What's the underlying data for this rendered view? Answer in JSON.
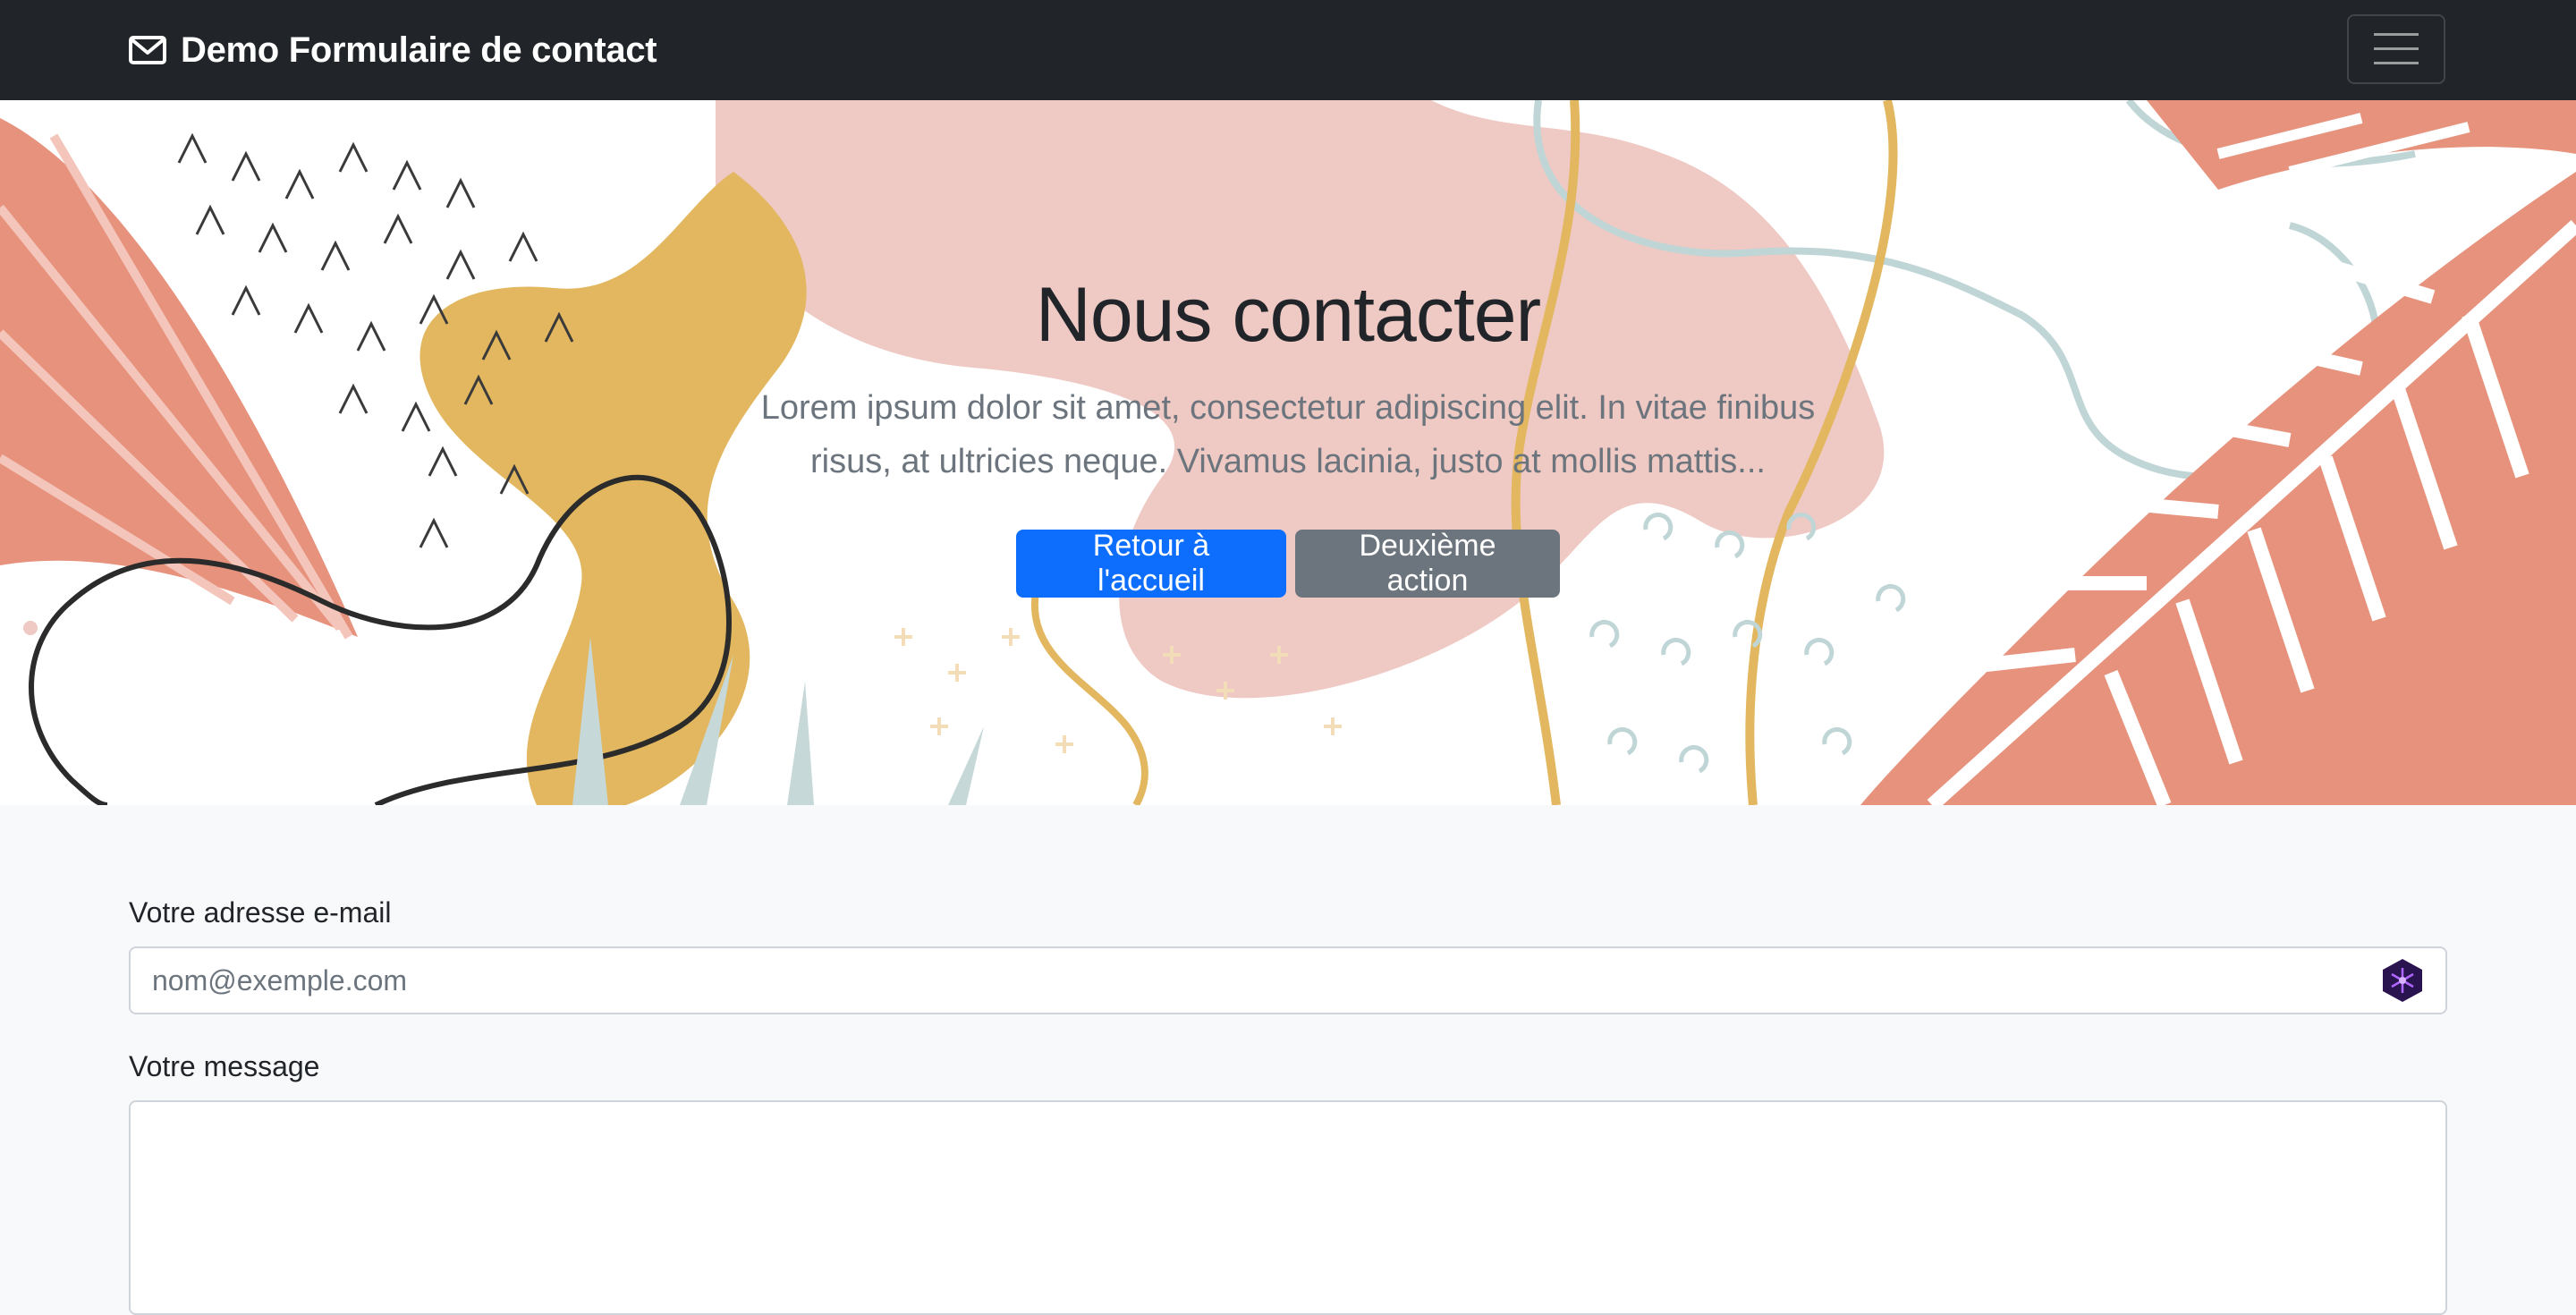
{
  "navbar": {
    "brand_text": "Demo Formulaire de contact",
    "brand_icon": "envelope-icon",
    "toggler_icon": "hamburger-icon"
  },
  "hero": {
    "title": "Nous contacter",
    "lead": "Lorem ipsum dolor sit amet, consectetur adipiscing elit. In vitae finibus risus, at ultricies neque. Vivamus lacinia, justo at mollis mattis...",
    "primary_button": "Retour à l'accueil",
    "secondary_button": "Deuxième action"
  },
  "form": {
    "email_label": "Votre adresse e-mail",
    "email_placeholder": "nom@exemple.com",
    "email_value": "",
    "message_label": "Votre message",
    "message_value": "",
    "extension_icon": "hexagon-extension-icon"
  },
  "colors": {
    "navbar_bg": "#212529",
    "primary": "#0d6efd",
    "secondary": "#6c757d",
    "page_bg": "#f8f9fa"
  }
}
